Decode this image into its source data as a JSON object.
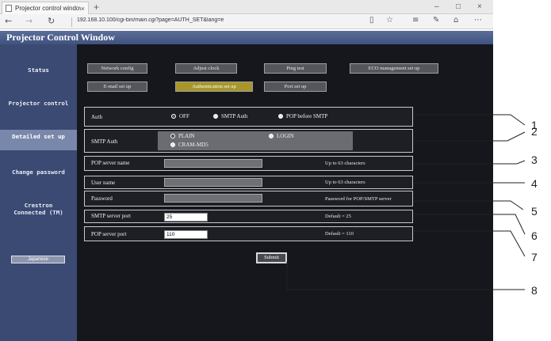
{
  "browser": {
    "tab_title": "Projector control window",
    "tab_close": "×",
    "new_tab": "+",
    "url": "192.168.10.100/cgi-bin/main.cgi?page=AUTH_SET&lang=e",
    "minimize": "–",
    "maximize": "□",
    "close": "×"
  },
  "page": {
    "title": "Projector Control Window"
  },
  "sidebar": {
    "items": [
      {
        "label": "Status"
      },
      {
        "label": "Projector control"
      },
      {
        "label": "Detailed set up"
      },
      {
        "label": "Change password"
      },
      {
        "label": "Crestron Connected (TM)"
      }
    ],
    "japanese": "Japanese"
  },
  "menu": {
    "row1": [
      "Network config",
      "Adjust clock",
      "Ping test",
      "ECO management set up"
    ],
    "row2": [
      "E-mail set up",
      "Authentication set up",
      "Port set up"
    ]
  },
  "form": {
    "auth": {
      "label": "Auth",
      "options": [
        "OFF",
        "SMTP Auth",
        "POP before SMTP"
      ],
      "selected": "OFF"
    },
    "smtp_auth": {
      "label": "SMTP Auth",
      "options": [
        "PLAIN",
        "LOGIN",
        "CRAM-MD5"
      ],
      "selected": "PLAIN"
    },
    "pop_server": {
      "label": "POP server name",
      "note": "Up to 63 characters"
    },
    "user_name": {
      "label": "User name",
      "note": "Up to 63 characters"
    },
    "password": {
      "label": "Password",
      "note": "Password for POP/SMTP server"
    },
    "smtp_port": {
      "label": "SMTP server port",
      "value": "25",
      "note": "Default = 25"
    },
    "pop_port": {
      "label": "POP server port",
      "value": "110",
      "note": "Default = 110"
    },
    "submit": "Submit"
  },
  "callouts": [
    "1",
    "2",
    "3",
    "4",
    "5",
    "6",
    "7",
    "8"
  ]
}
